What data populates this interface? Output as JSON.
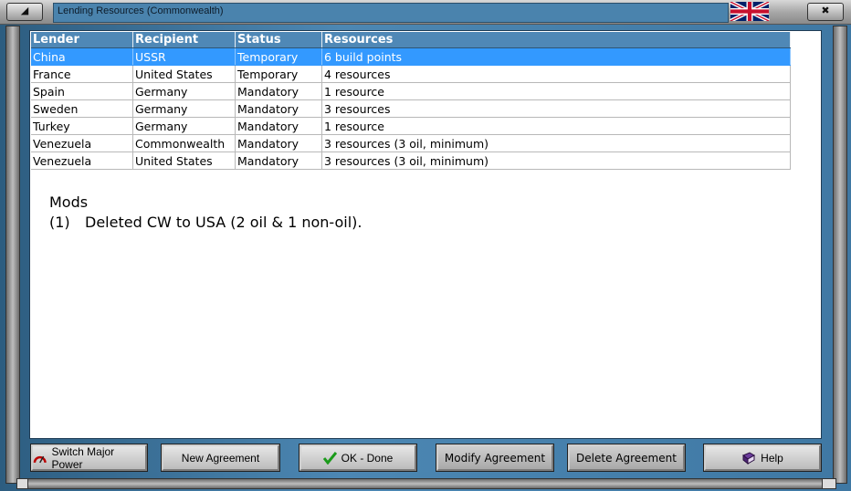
{
  "window": {
    "title": "Lending Resources (Commonwealth)"
  },
  "table": {
    "headers": [
      "Lender",
      "Recipient",
      "Status",
      "Resources"
    ],
    "rows": [
      {
        "lender": "China",
        "recipient": "USSR",
        "status": "Temporary",
        "resources": "6 build points",
        "selected": true
      },
      {
        "lender": "France",
        "recipient": "United States",
        "status": "Temporary",
        "resources": "4 resources"
      },
      {
        "lender": "Spain",
        "recipient": "Germany",
        "status": "Mandatory",
        "resources": "1 resource"
      },
      {
        "lender": "Sweden",
        "recipient": "Germany",
        "status": "Mandatory",
        "resources": "3 resources"
      },
      {
        "lender": "Turkey",
        "recipient": "Germany",
        "status": "Mandatory",
        "resources": "1 resource"
      },
      {
        "lender": "Venezuela",
        "recipient": "Commonwealth",
        "status": "Mandatory",
        "resources": "3 resources (3 oil, minimum)"
      },
      {
        "lender": "Venezuela",
        "recipient": "United States",
        "status": "Mandatory",
        "resources": "3 resources (3 oil, minimum)"
      }
    ]
  },
  "mods": {
    "heading": "Mods",
    "items": [
      {
        "num": "(1)",
        "text": "Deleted CW to USA (2 oil & 1 non-oil)."
      }
    ]
  },
  "buttons": {
    "switch_major_power": "Switch Major Power",
    "new_agreement": "New Agreement",
    "ok_done": "OK - Done",
    "modify_agreement": "Modify Agreement",
    "delete_agreement": "Delete Agreement",
    "help": "Help"
  },
  "icons": {
    "switch_major_power": "gauge-icon",
    "ok_done": "checkmark-icon",
    "help": "help-book-icon",
    "flag": "uk-flag-icon"
  },
  "colors": {
    "header_bg": "#4f88b6",
    "selected_row": "#3399ff",
    "frame_blue": "#3f78a3"
  }
}
